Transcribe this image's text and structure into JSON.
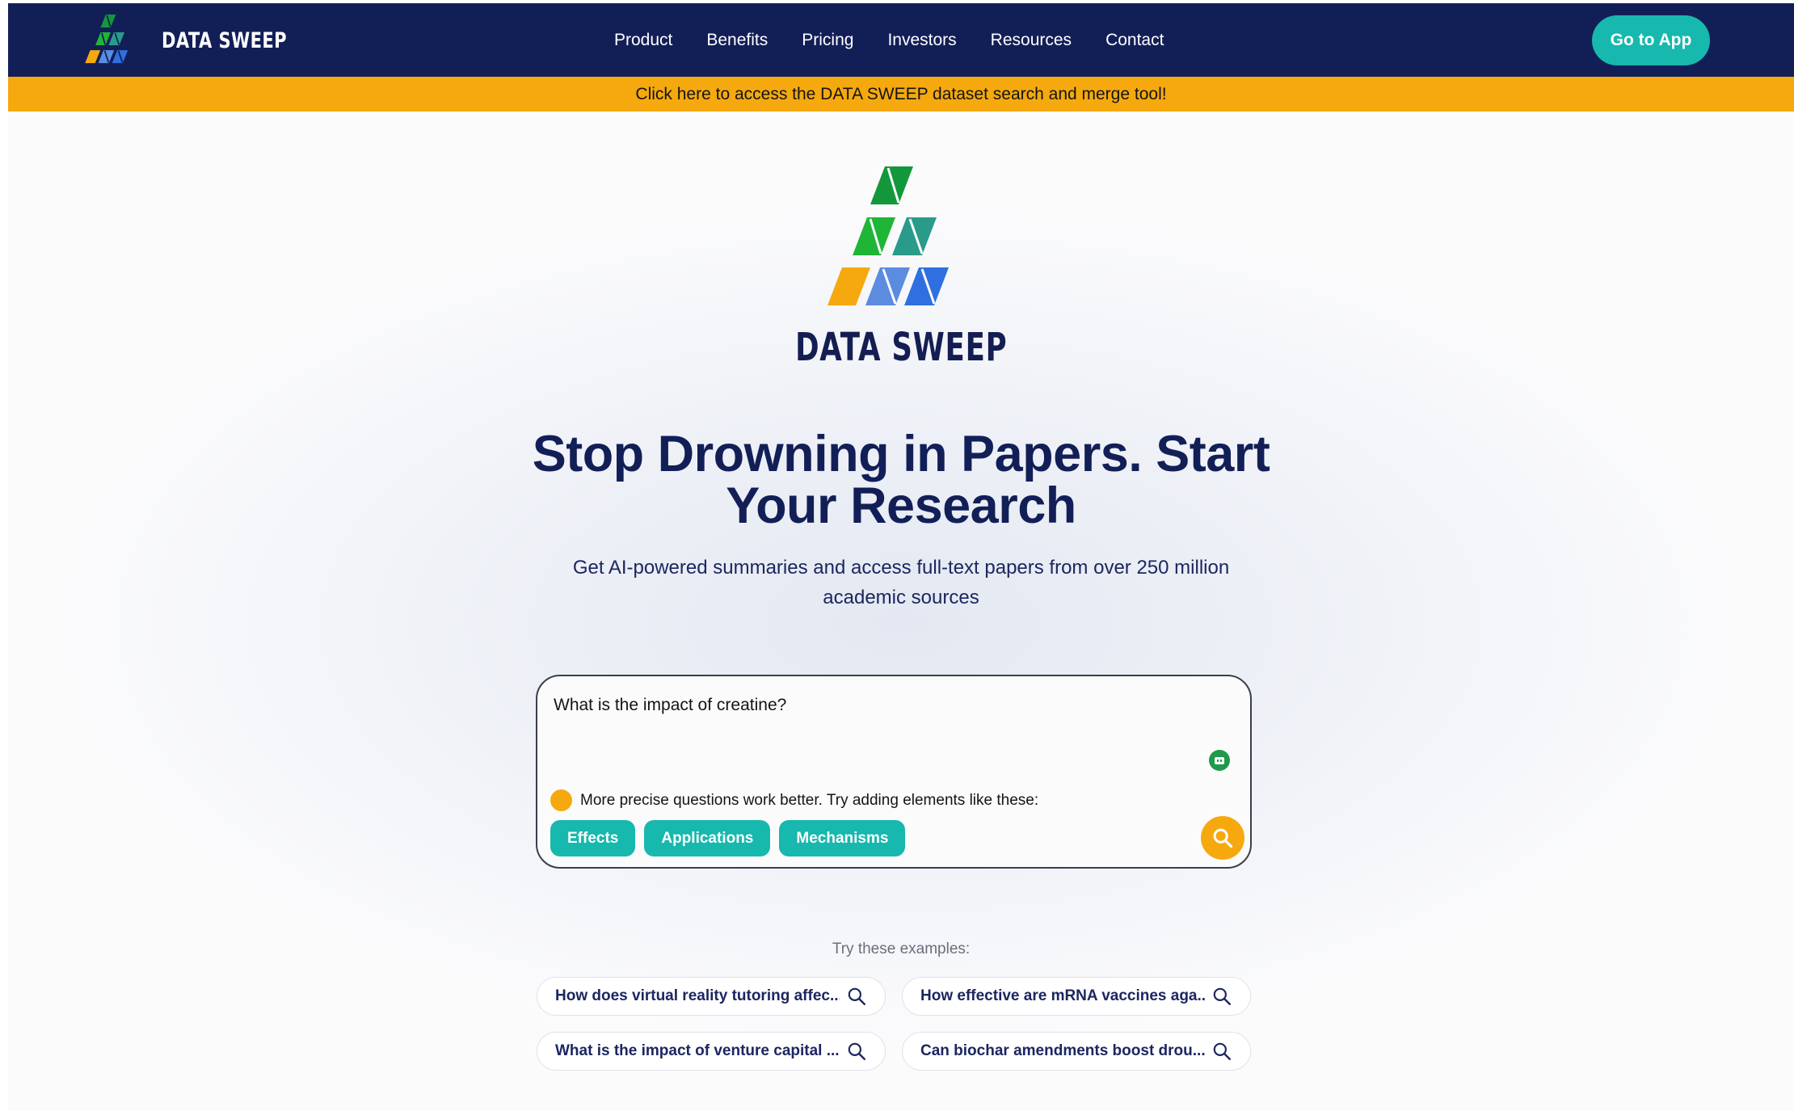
{
  "brand": {
    "name": "DATA SWEEP"
  },
  "nav": {
    "links": [
      "Product",
      "Benefits",
      "Pricing",
      "Investors",
      "Resources",
      "Contact"
    ],
    "cta": "Go to App"
  },
  "banner": {
    "text": "Click here to access the DATA SWEEP dataset search and merge tool!"
  },
  "hero": {
    "logo_text": "DATA SWEEP",
    "headline_line1": "Stop Drowning in Papers. Start",
    "headline_line2": "Your Research",
    "subhead_line1": "Get AI-powered summaries and access full-text papers from over 250 million",
    "subhead_line2": "academic sources"
  },
  "search": {
    "query_value": "What is the impact of creatine?",
    "hint": "More precise questions work better. Try adding elements like these:",
    "chips": [
      "Effects",
      "Applications",
      "Mechanisms"
    ]
  },
  "examples": {
    "label": "Try these examples:",
    "items": [
      "How does virtual reality tutoring affec...",
      "How effective are mRNA vaccines aga...",
      "What is the impact of venture capital ...",
      "Can biochar amendments boost drou..."
    ]
  },
  "colors": {
    "navy": "#121f57",
    "teal": "#17b8ad",
    "amber": "#f5a90e",
    "logo_green_dark": "#12983a",
    "logo_green": "#1fb537",
    "logo_teal": "#2a9b8a",
    "logo_blue_light": "#5b8ce0",
    "logo_blue": "#2f6fe0"
  },
  "icons": {
    "logo": "data-sweep-logo",
    "search": "search-icon",
    "assist": "robot-icon",
    "hint": "lightbulb-dot-icon"
  }
}
